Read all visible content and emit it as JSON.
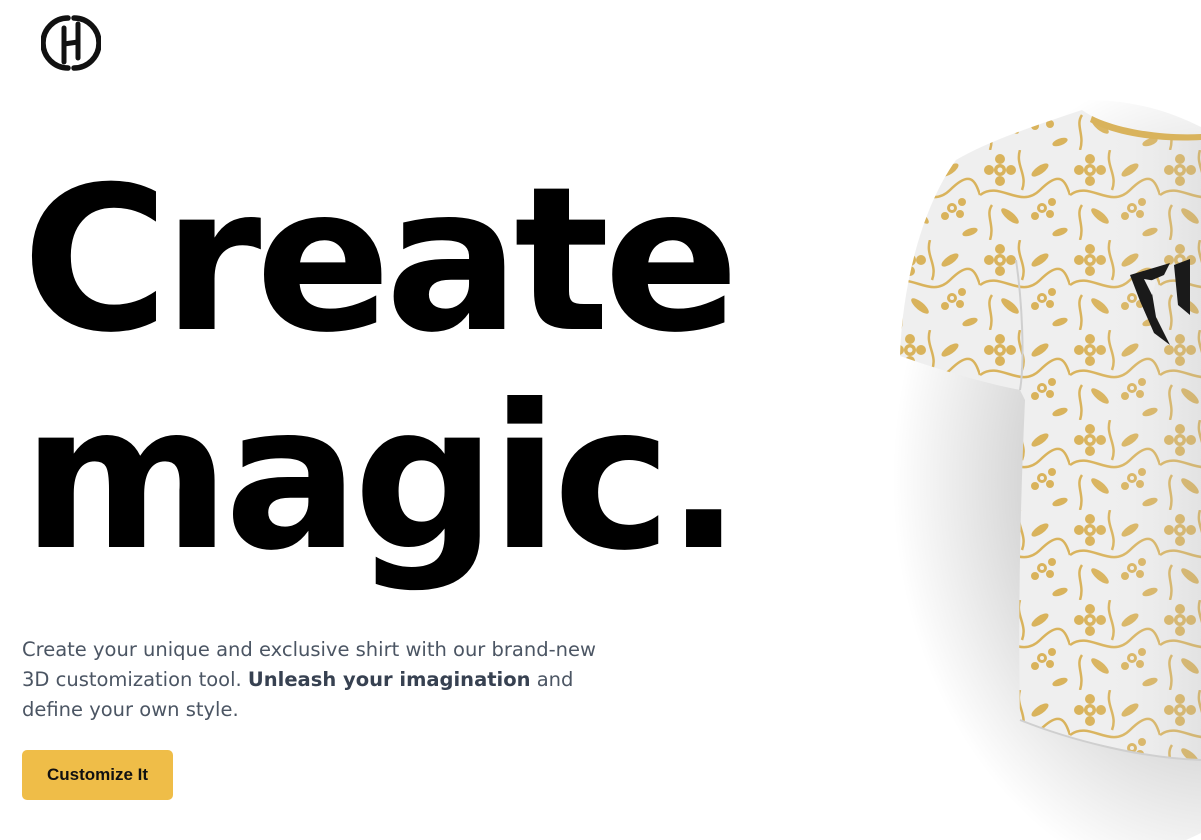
{
  "hero": {
    "title_line1": "Create",
    "title_line2": "magic.",
    "description_part1": "Create your unique and exclusive shirt with our brand-new 3D customization tool.",
    "description_highlight": "Unleash your imagination",
    "description_part2": "and define your own style."
  },
  "cta": {
    "label": "Customize It"
  },
  "logo": {
    "icon": "h-monogram-icon"
  },
  "shirt": {
    "pattern": "gold-floral",
    "base_color": "#efefef",
    "pattern_color": "#d9b35c",
    "emblem_color": "#1a1a1a"
  },
  "colors": {
    "accent": "#efbd48",
    "text": "#000000",
    "body_text": "#4b5563"
  }
}
